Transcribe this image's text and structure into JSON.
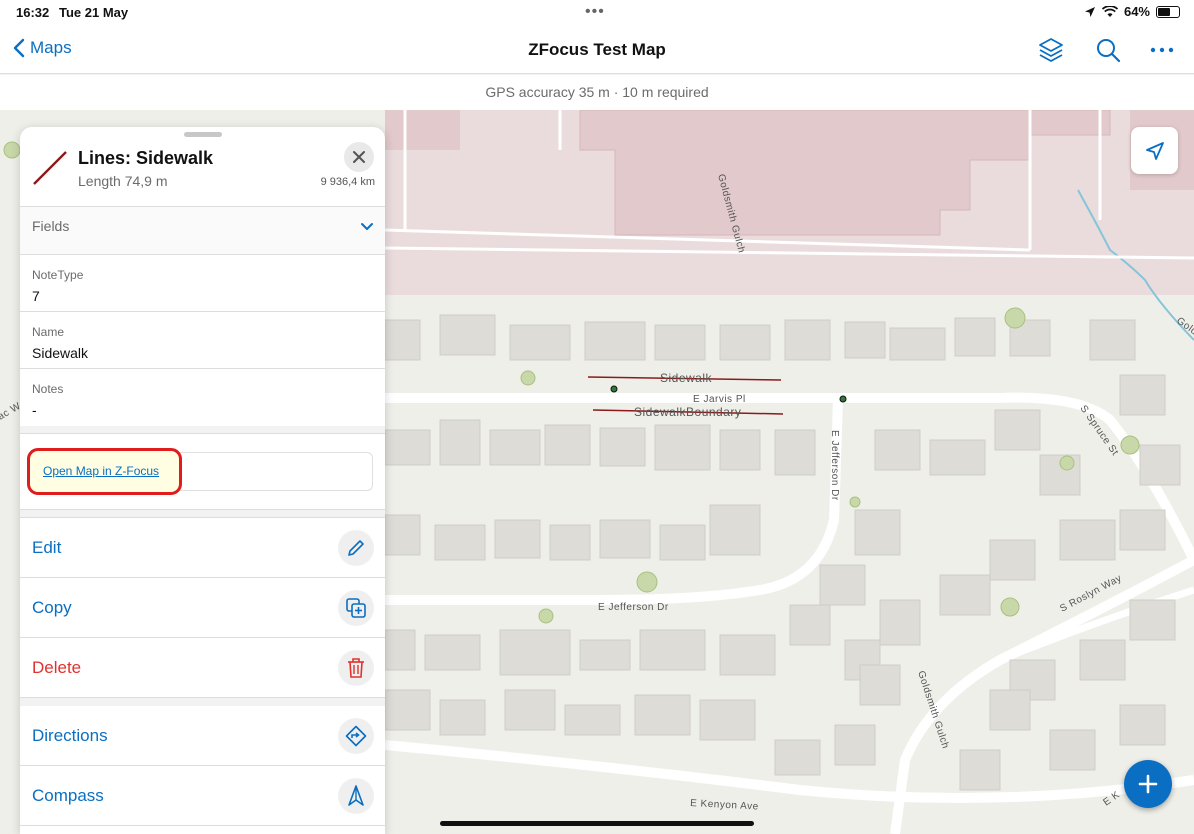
{
  "status_bar": {
    "time": "16:32",
    "date": "Tue 21 May",
    "battery": "64%",
    "battery_level": 0.64,
    "dots": "•••"
  },
  "nav": {
    "back_label": "Maps",
    "title": "ZFocus Test Map"
  },
  "gps": {
    "text": "GPS accuracy 35 m  ·  10 m required"
  },
  "feature": {
    "title": "Lines: Sidewalk",
    "length": "Length 74,9 m",
    "distance": "9 936,4 km",
    "fields_label": "Fields",
    "fields": [
      {
        "label": "NoteType",
        "value": "7"
      },
      {
        "label": "Name",
        "value": "Sidewalk"
      },
      {
        "label": "Notes",
        "value": "-"
      }
    ],
    "link_text": "Open Map in Z-Focus"
  },
  "actions": {
    "edit": "Edit",
    "copy": "Copy",
    "delete": "Delete",
    "directions": "Directions",
    "compass": "Compass"
  },
  "map_labels": {
    "goldsmith_gulch": "Goldsmith Gulch",
    "goldsmith_gulch_2": "Goldsmith Gulch",
    "e_jarvis_pl": "E Jarvis Pl",
    "e_jefferson_dr_vertical": "E Jefferson Dr",
    "e_jefferson_dr": "E Jefferson Dr",
    "s_spruce_st": "S Spruce St",
    "s_roslyn_way": "S Roslyn Way",
    "e_kenyon_ave": "E Kenyon Ave",
    "sidewalk": "Sidewalk",
    "sidewalk_boundary": "SidewalkBoundary",
    "gold_partial": "Gold",
    "e_partial": "E K",
    "ac_partial": "ac W"
  },
  "colors": {
    "accent": "#0a6fc2",
    "danger": "#e0322d",
    "feature_line": "#8b1a1a",
    "highlight": "#e01c1c",
    "commercial": "#eadcdc"
  }
}
